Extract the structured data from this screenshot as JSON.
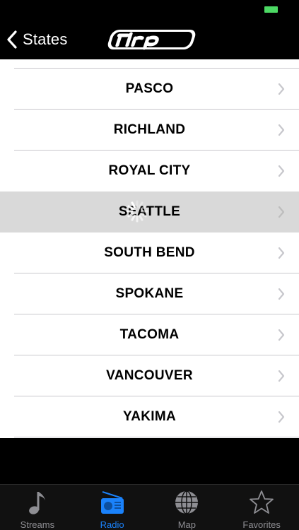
{
  "nav": {
    "back_label": "States"
  },
  "list": {
    "items": [
      {
        "label": "PASCO"
      },
      {
        "label": "RICHLAND"
      },
      {
        "label": "ROYAL CITY"
      },
      {
        "label": "SEATTLE"
      },
      {
        "label": "SOUTH BEND"
      },
      {
        "label": "SPOKANE"
      },
      {
        "label": "TACOMA"
      },
      {
        "label": "VANCOUVER"
      },
      {
        "label": "YAKIMA"
      }
    ],
    "selected_index": 3
  },
  "tabs": [
    {
      "label": "Streams",
      "icon": "music-note-icon"
    },
    {
      "label": "Radio",
      "icon": "radio-icon"
    },
    {
      "label": "Map",
      "icon": "globe-icon"
    },
    {
      "label": "Favorites",
      "icon": "star-icon"
    }
  ],
  "active_tab": 1,
  "colors": {
    "accent": "#1a82fb",
    "battery": "#4cd964",
    "selected_row": "#d9d9d9"
  }
}
